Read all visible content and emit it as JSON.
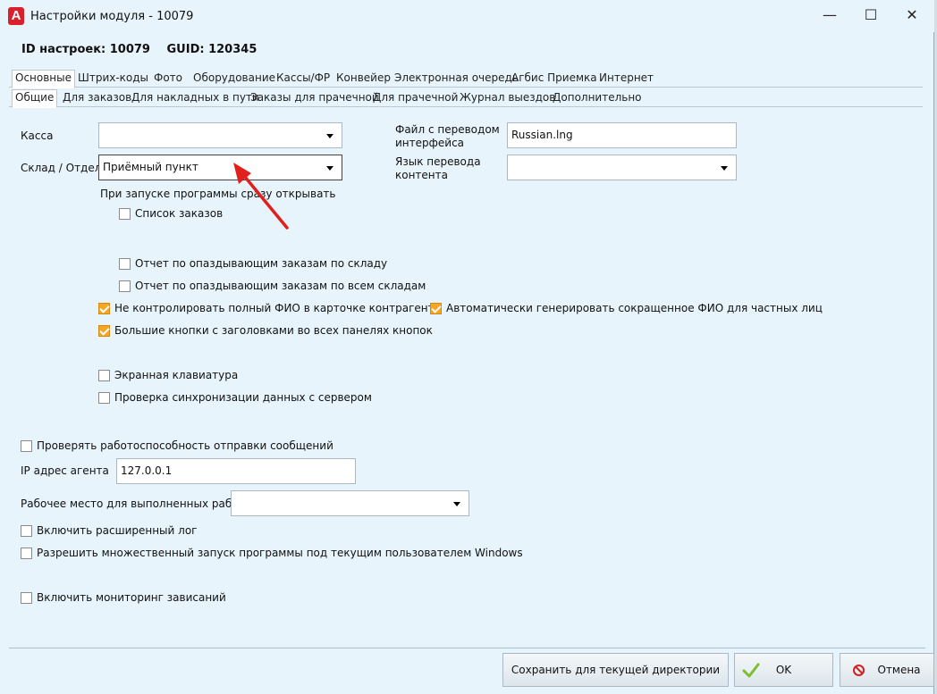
{
  "window": {
    "title": "Настройки модуля  - 10079",
    "logo_letter": "A",
    "controls": {
      "minimize": "—",
      "maximize": "☐",
      "close": "✕"
    }
  },
  "header": {
    "id_label": "ID настроек: 10079",
    "guid_label": "GUID: 120345"
  },
  "tabs_main": [
    {
      "label": "Основные",
      "active": true
    },
    {
      "label": "Штрих-коды"
    },
    {
      "label": "Фото"
    },
    {
      "label": "Оборудование"
    },
    {
      "label": "Кассы/ФР"
    },
    {
      "label": "Конвейер"
    },
    {
      "label": "Электронная очередь"
    },
    {
      "label": "Агбис Приемка"
    },
    {
      "label": "Интернет"
    }
  ],
  "tabs_sub": [
    {
      "label": "Общие",
      "active": true
    },
    {
      "label": "Для заказов"
    },
    {
      "label": "Для накладных в пути"
    },
    {
      "label": "Заказы для прачечной"
    },
    {
      "label": "Для прачечной"
    },
    {
      "label": "Журнал выездов"
    },
    {
      "label": "Дополнительно"
    }
  ],
  "fields": {
    "kassa": {
      "label": "Касса",
      "value": ""
    },
    "sklad": {
      "label": "Склад / Отдел",
      "value": "Приёмный пункт"
    },
    "translation_file": {
      "label_line1": "Файл с переводом",
      "label_line2": "интерфейса",
      "value": "Russian.lng"
    },
    "content_language": {
      "label_line1": "Язык перевода",
      "label_line2": "контента",
      "value": ""
    },
    "startup_heading": "При запуске программы сразу открывать",
    "ip_agent": {
      "label": "IP адрес агента",
      "value": "127.0.0.1"
    },
    "workplace": {
      "label": "Рабочее место для выполненных работ",
      "value": ""
    }
  },
  "checkboxes": {
    "order_list": {
      "label": "Список заказов",
      "checked": false
    },
    "late_report_warehouse": {
      "label": "Отчет по опаздывающим заказам по складу",
      "checked": false
    },
    "late_report_all": {
      "label": "Отчет по опаздывающим заказам по всем складам",
      "checked": false
    },
    "no_full_name_control": {
      "label": "Не контролировать полный ФИО в карточке контрагента",
      "checked": true
    },
    "auto_short_name": {
      "label": "Автоматически генерировать сокращенное ФИО для частных лиц",
      "checked": true
    },
    "big_buttons": {
      "label": "Большие кнопки с заголовками во всех панелях кнопок",
      "checked": true
    },
    "onscreen_keyboard": {
      "label": "Экранная клавиатура",
      "checked": false
    },
    "sync_check": {
      "label": "Проверка синхронизации данных с сервером",
      "checked": false
    },
    "check_messages": {
      "label": "Проверять работоспособность отправки сообщений",
      "checked": false
    },
    "extended_log": {
      "label": "Включить расширенный лог",
      "checked": false
    },
    "multi_launch": {
      "label": "Разрешить множественный запуск программы под текущим пользователем Windows",
      "checked": false
    },
    "hang_monitoring": {
      "label": "Включить мониторинг зависаний",
      "checked": false
    }
  },
  "buttons": {
    "save_dir": "Сохранить для текущей директории",
    "ok": "OK",
    "cancel": "Отмена"
  },
  "colors": {
    "window_bg": "#e8f4fb",
    "checkbox_checked": "#f5a623",
    "logo": "#d9212c",
    "annotation_arrow": "#e0201c",
    "ok_check": "#7cbf2e"
  }
}
